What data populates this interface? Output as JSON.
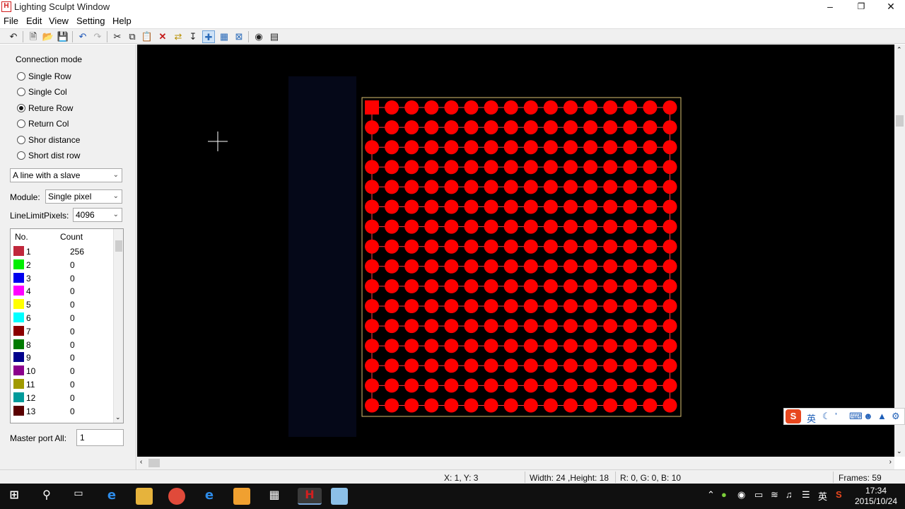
{
  "window": {
    "title": "Lighting Sculpt Window",
    "app_icon": "H"
  },
  "menu": [
    "File",
    "Edit",
    "View",
    "Setting",
    "Help"
  ],
  "connection": {
    "title": "Connection mode",
    "options": [
      "Single Row",
      "Single Col",
      "Reture Row",
      "Return Col",
      "Shor distance",
      "Short dist row"
    ],
    "selected": "Reture Row"
  },
  "controls": {
    "slave_mode": "A line with a slave",
    "module_label": "Module:",
    "module_value": "Single pixel",
    "line_limit_label": "LineLimitPixels:",
    "line_limit_value": "4096",
    "master_port_label": "Master port All:",
    "master_port_value": "1"
  },
  "port_list": {
    "headers": {
      "no": "No.",
      "count": "Count"
    },
    "rows": [
      {
        "no": "1",
        "count": "256",
        "color": "#c0283c"
      },
      {
        "no": "2",
        "count": "0",
        "color": "#00ee00"
      },
      {
        "no": "3",
        "count": "0",
        "color": "#0000ee"
      },
      {
        "no": "4",
        "count": "0",
        "color": "#ff00ff"
      },
      {
        "no": "5",
        "count": "0",
        "color": "#ffff00"
      },
      {
        "no": "6",
        "count": "0",
        "color": "#00ffff"
      },
      {
        "no": "7",
        "count": "0",
        "color": "#8b0000"
      },
      {
        "no": "8",
        "count": "0",
        "color": "#007a00"
      },
      {
        "no": "9",
        "count": "0",
        "color": "#00008b"
      },
      {
        "no": "10",
        "count": "0",
        "color": "#8b008b"
      },
      {
        "no": "11",
        "count": "0",
        "color": "#a09a00"
      },
      {
        "no": "12",
        "count": "0",
        "color": "#009a9a"
      },
      {
        "no": "13",
        "count": "0",
        "color": "#5a0000"
      }
    ]
  },
  "grid": {
    "cols": 16,
    "rows": 16,
    "pixel_color": "#ff0000",
    "border_color": "#d8c070"
  },
  "status": {
    "coords": "X: 1, Y: 3",
    "dims": "Width: 24 ,Height: 18",
    "rgb": "R:  0, G:  0, B: 10",
    "frames": "Frames: 59"
  },
  "ime": {
    "lang": "英"
  },
  "taskbar": {
    "tray_lang": "英",
    "time": "17:34",
    "date": "2015/10/24"
  }
}
